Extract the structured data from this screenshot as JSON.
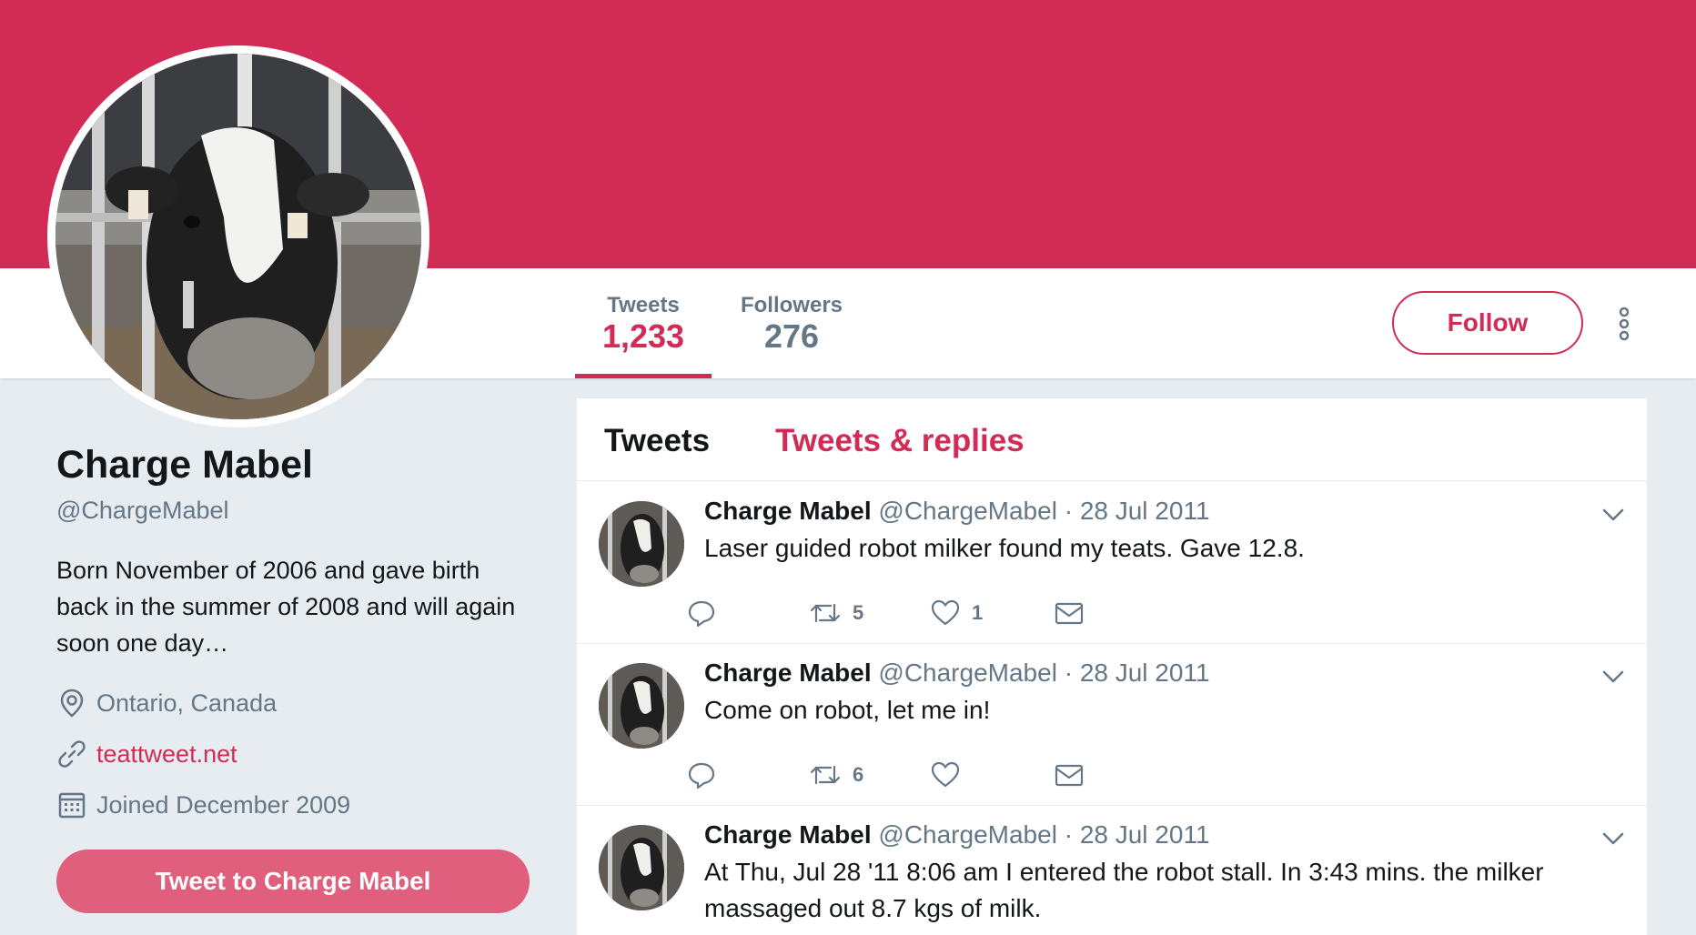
{
  "profile": {
    "name": "Charge Mabel",
    "handle": "@ChargeMabel",
    "bio": "Born November of 2006 and gave birth back in the summer of 2008 and will again soon one day…",
    "location": "Ontario, Canada",
    "website": "teattweet.net",
    "joined": "Joined December 2009",
    "tweet_to_label": "Tweet to Charge Mabel"
  },
  "stats": {
    "tweets_label": "Tweets",
    "tweets_value": "1,233",
    "followers_label": "Followers",
    "followers_value": "276"
  },
  "actions": {
    "follow_label": "Follow"
  },
  "timeline": {
    "tabs": [
      "Tweets",
      "Tweets & replies"
    ],
    "tweets": [
      {
        "name": "Charge Mabel",
        "handle": "@ChargeMabel",
        "separator": "·",
        "date": "28 Jul 2011",
        "text": "Laser guided robot milker found my teats. Gave 12.8.",
        "retweets": "5",
        "likes": "1"
      },
      {
        "name": "Charge Mabel",
        "handle": "@ChargeMabel",
        "separator": "·",
        "date": "28 Jul 2011",
        "text": "Come on robot, let me in!",
        "retweets": "6",
        "likes": ""
      },
      {
        "name": "Charge Mabel",
        "handle": "@ChargeMabel",
        "separator": "·",
        "date": "28 Jul 2011",
        "text": "At Thu, Jul 28 '11 8:06 am I entered the robot stall. In 3:43 mins. the milker massaged out 8.7 kgs of milk.",
        "retweets": "",
        "likes": ""
      }
    ]
  },
  "colors": {
    "accent": "#d22b55",
    "banner": "#d22b55",
    "tweet_button": "#df5f7c",
    "muted_text": "#657786",
    "page_background": "#e6ecf0"
  },
  "icons": {
    "location": "location-pin-icon",
    "website": "link-icon",
    "joined": "calendar-icon",
    "reply": "reply-icon",
    "retweet": "retweet-icon",
    "like": "heart-icon",
    "message": "envelope-icon",
    "more": "more-vertical-icon",
    "caret": "chevron-down-icon"
  }
}
